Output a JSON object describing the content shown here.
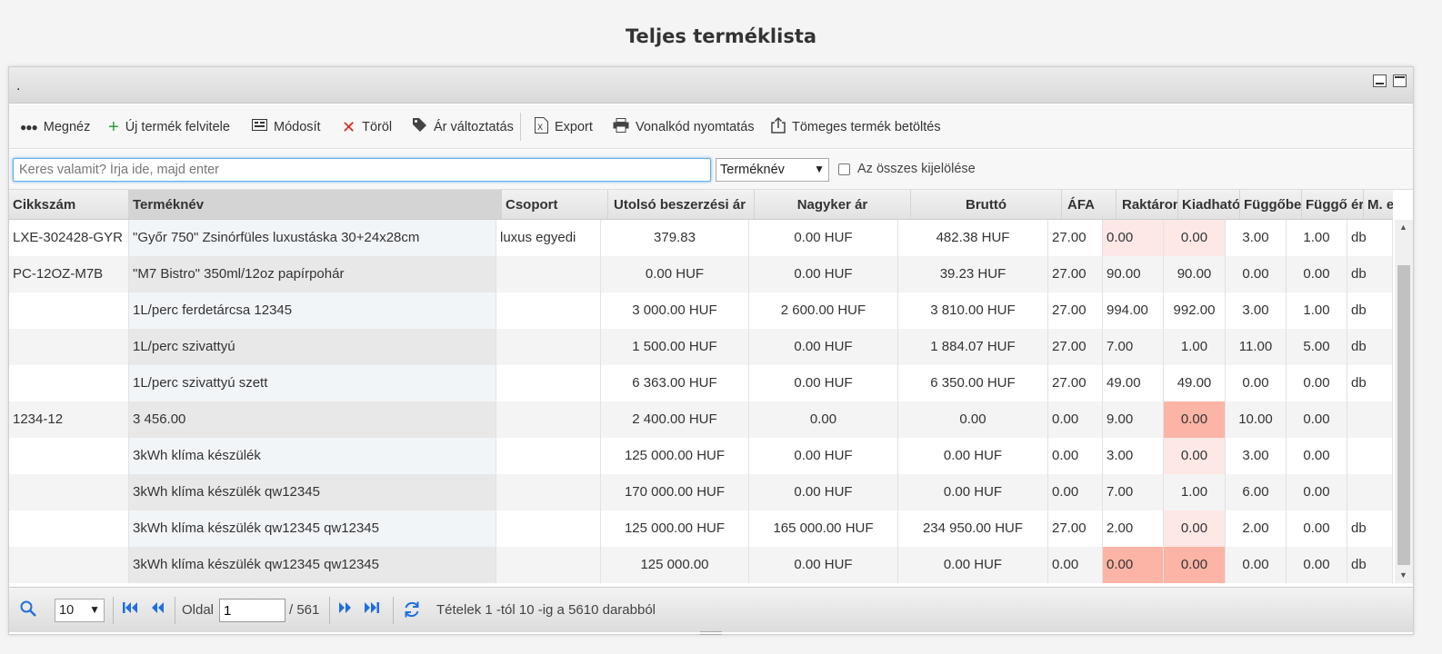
{
  "page_title": "Teljes terméklista",
  "panel": {
    "caption": "."
  },
  "toolbar": {
    "view": "Megnéz",
    "add": "Új termék felvitele",
    "edit": "Módosít",
    "delete": "Töröl",
    "price_change": "Ár változtatás",
    "export": "Export",
    "barcode_print": "Vonalkód nyomtatás",
    "bulk_import": "Tömeges termék betöltés"
  },
  "search": {
    "placeholder": "Keres valamit? Írja ide, majd enter",
    "field_select": "Terméknév",
    "select_all_label": "Az összes kijelölése"
  },
  "columns": [
    "Cikkszám",
    "Terméknév",
    "Csoport",
    "Utolsó beszerzési ár",
    "Nagyker ár",
    "Bruttó",
    "ÁFA",
    "Raktáron",
    "Kiadható",
    "Függőbe",
    "Függő ér",
    "M. egy"
  ],
  "rows": [
    {
      "sku": "LXE-302428-GYR",
      "name": "\"Győr 750\" Zsinórfüles luxustáska 30+24x28cm",
      "group": "luxus egyedi",
      "purchase": "379.83",
      "wholesale": "0.00 HUF",
      "gross": "482.38 HUF",
      "vat": "27.00",
      "stock": "0.00",
      "available": "0.00",
      "pending": "3.00",
      "pending_val": "1.00",
      "unit": "db",
      "stock_hl": "low",
      "avail_hl": "low"
    },
    {
      "sku": "PC-12OZ-M7B",
      "name": "\"M7 Bistro\" 350ml/12oz papírpohár",
      "group": "",
      "purchase": "0.00 HUF",
      "wholesale": "0.00 HUF",
      "gross": "39.23 HUF",
      "vat": "27.00",
      "stock": "90.00",
      "available": "90.00",
      "pending": "0.00",
      "pending_val": "0.00",
      "unit": "db",
      "stock_hl": "",
      "avail_hl": ""
    },
    {
      "sku": "",
      "name": "1L/perc ferdetárcsa 12345",
      "group": "",
      "purchase": "3 000.00 HUF",
      "wholesale": "2 600.00 HUF",
      "gross": "3 810.00 HUF",
      "vat": "27.00",
      "stock": "994.00",
      "available": "992.00",
      "pending": "3.00",
      "pending_val": "1.00",
      "unit": "db",
      "stock_hl": "",
      "avail_hl": ""
    },
    {
      "sku": "",
      "name": "1L/perc szivattyú",
      "group": "",
      "purchase": "1 500.00 HUF",
      "wholesale": "0.00 HUF",
      "gross": "1 884.07 HUF",
      "vat": "27.00",
      "stock": "7.00",
      "available": "1.00",
      "pending": "11.00",
      "pending_val": "5.00",
      "unit": "db",
      "stock_hl": "",
      "avail_hl": ""
    },
    {
      "sku": "",
      "name": "1L/perc szivattyú szett",
      "group": "",
      "purchase": "6 363.00 HUF",
      "wholesale": "0.00 HUF",
      "gross": "6 350.00 HUF",
      "vat": "27.00",
      "stock": "49.00",
      "available": "49.00",
      "pending": "0.00",
      "pending_val": "0.00",
      "unit": "db",
      "stock_hl": "",
      "avail_hl": ""
    },
    {
      "sku": "1234-12",
      "name": "3 456.00",
      "group": "",
      "purchase": "2 400.00 HUF",
      "wholesale": "0.00",
      "gross": "0.00",
      "vat": "0.00",
      "stock": "9.00",
      "available": "0.00",
      "pending": "10.00",
      "pending_val": "0.00",
      "unit": "",
      "stock_hl": "",
      "avail_hl": "zero"
    },
    {
      "sku": "",
      "name": "3kWh klíma készülék",
      "group": "",
      "purchase": "125 000.00 HUF",
      "wholesale": "0.00 HUF",
      "gross": "0.00 HUF",
      "vat": "0.00",
      "stock": "3.00",
      "available": "0.00",
      "pending": "3.00",
      "pending_val": "0.00",
      "unit": "",
      "stock_hl": "",
      "avail_hl": "low"
    },
    {
      "sku": "",
      "name": "3kWh klíma készülék qw12345",
      "group": "",
      "purchase": "170 000.00 HUF",
      "wholesale": "0.00 HUF",
      "gross": "0.00 HUF",
      "vat": "0.00",
      "stock": "7.00",
      "available": "1.00",
      "pending": "6.00",
      "pending_val": "0.00",
      "unit": "",
      "stock_hl": "",
      "avail_hl": ""
    },
    {
      "sku": "",
      "name": "3kWh klíma készülék qw12345 qw12345",
      "group": "",
      "purchase": "125 000.00 HUF",
      "wholesale": "165 000.00 HUF",
      "gross": "234 950.00 HUF",
      "vat": "27.00",
      "stock": "2.00",
      "available": "0.00",
      "pending": "2.00",
      "pending_val": "0.00",
      "unit": "db",
      "stock_hl": "",
      "avail_hl": "low"
    },
    {
      "sku": "",
      "name": "3kWh klíma készülék qw12345 qw12345",
      "group": "",
      "purchase": "125 000.00",
      "wholesale": "0.00 HUF",
      "gross": "0.00 HUF",
      "vat": "0.00",
      "stock": "0.00",
      "available": "0.00",
      "pending": "0.00",
      "pending_val": "0.00",
      "unit": "db",
      "stock_hl": "zero",
      "avail_hl": "zero"
    }
  ],
  "pager": {
    "page_size": "10",
    "page_label": "Oldal",
    "page_value": "1",
    "total_pages": "/ 561",
    "summary": "Tételek 1 -tól 10 -ig a 5610 darabból"
  },
  "colors": {
    "accent": "#1f6fe0",
    "low_stock": "#fde8e6",
    "zero_stock": "#fbb4a6"
  }
}
